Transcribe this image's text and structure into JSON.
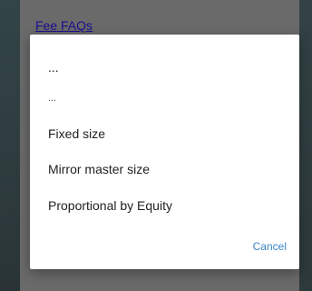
{
  "background": {
    "link_label": "Fee FAQs"
  },
  "dialog": {
    "options": [
      {
        "label": "..."
      },
      {
        "label": "..."
      },
      {
        "label": "Fixed size"
      },
      {
        "label": "Mirror master size"
      },
      {
        "label": "Proportional by Equity"
      }
    ],
    "cancel_label": "Cancel"
  },
  "colors": {
    "accent": "#3a86c8",
    "link": "#1a0f8f",
    "scrim": "#6a6a6a"
  }
}
